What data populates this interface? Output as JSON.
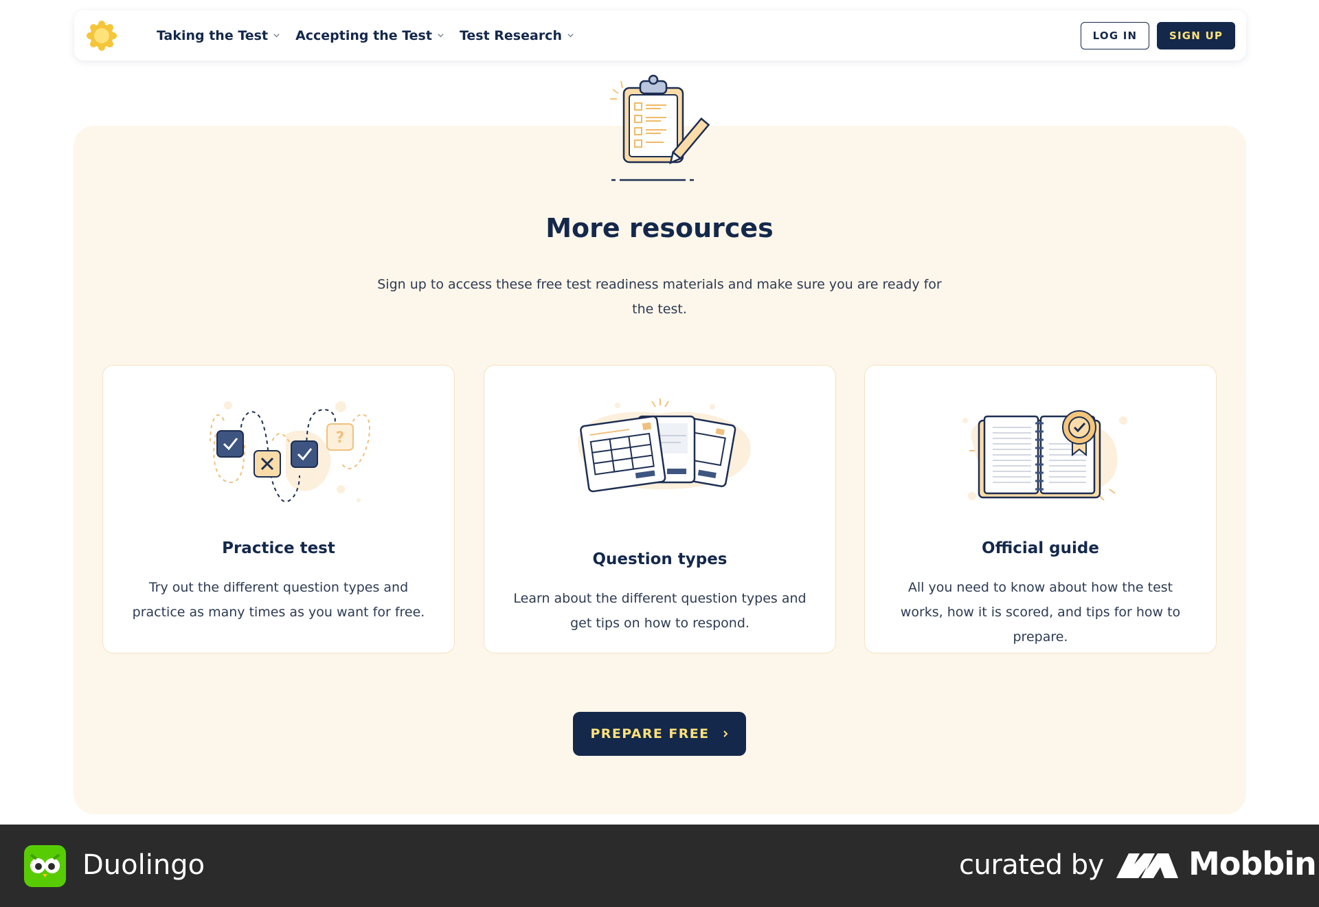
{
  "nav": {
    "links": [
      {
        "label": "Taking the Test",
        "active": true
      },
      {
        "label": "Accepting the Test",
        "active": false
      },
      {
        "label": "Test Research",
        "active": false
      }
    ],
    "login_label": "LOG IN",
    "signup_label": "SIGN UP"
  },
  "resources": {
    "title": "More resources",
    "subtitle": "Sign up to access these free test readiness materials and make sure you are ready for the test.",
    "cards": [
      {
        "title": "Practice test",
        "description": "Try out the different question types and practice as many times as you want for free.",
        "icon": "practice-test-illustration"
      },
      {
        "title": "Question types",
        "description": "Learn about the different question types and get tips on how to respond.",
        "icon": "question-types-illustration"
      },
      {
        "title": "Official guide",
        "description": "All you need to know about how the test works, how it is scored, and tips for how to prepare.",
        "icon": "official-guide-illustration"
      }
    ],
    "cta_label": "PREPARE FREE"
  },
  "footer": {
    "app_name": "Duolingo",
    "curated_by": "curated by",
    "brand": "Mobbin"
  },
  "colors": {
    "navy": "#14284b",
    "accent_yellow": "#ffe27a",
    "panel_bg": "#fdf6ea",
    "footer_bg": "#2b2b2b"
  }
}
